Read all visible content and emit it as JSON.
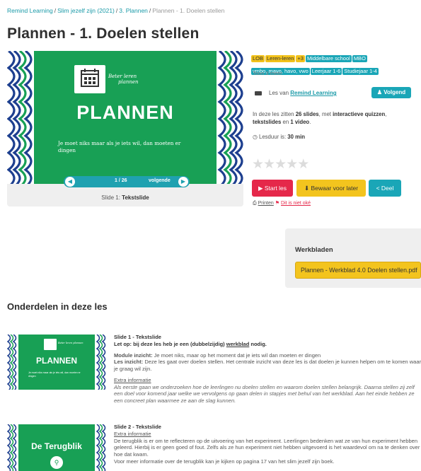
{
  "breadcrumb": {
    "items": [
      "Remind Learning",
      "Slim jezelf zijn (2021)",
      "3. Plannen",
      "Plannen - 1. Doelen stellen"
    ],
    "separator": "/"
  },
  "page_title": "Plannen - 1. Doelen stellen",
  "slide_preview": {
    "logo_text_line1": "Beter leren",
    "logo_text_line2": "plannen",
    "title": "PLANNEN",
    "text": "Je moet niks maar als je iets wil, dan moeten er dingen",
    "counter": "1 / 26",
    "next_label": "volgende",
    "caption_prefix": "Slide 1: ",
    "caption_type": "Tekstslide"
  },
  "tags": {
    "yellow": [
      "LOB",
      "Leren-leren",
      "+3"
    ],
    "teal": [
      "Middelbare school",
      "MBO",
      "vmbo, mavo, havo, vwo",
      "Leerjaar 1-6",
      "Studiejaar 1-4"
    ],
    "show_more": "Toon 3 meer"
  },
  "author": {
    "prefix": "Les van",
    "name": "Remind Learning",
    "follow_label": "Volgend"
  },
  "description": {
    "part1": "In deze les zitten ",
    "slides": "26 slides",
    "part2": ", met ",
    "quizzes": "interactieve quizzen",
    "part3": ", ",
    "textslides": "tekstslides",
    "part4": " en ",
    "videos": "1 video",
    "part5": "."
  },
  "duration": {
    "label": "Lesduur is: ",
    "value": "30 min"
  },
  "rating": {
    "value": 0,
    "max": 5
  },
  "actions": {
    "start": "Start les",
    "save": "Bewaar voor later",
    "share": "Deel"
  },
  "small_links": {
    "print": "Printen",
    "report": "Dit is niet oké"
  },
  "werkbladen": {
    "title": "Werkbladen",
    "file": "Plannen - Werkblad 4.0 Doelen stellen.pdf"
  },
  "section_title": "Onderdelen in deze les",
  "items": [
    {
      "thumb_title": "PLANNEN",
      "thumb_logo_text": "Beter leren plannen",
      "thumb_small_text": "Je moet niks maar als je iets wil, dan moeten er dingen",
      "heading": "Slide 1 - Tekstslide",
      "note_prefix": "Let op: bij deze les heb je een (dubbelzijdig) ",
      "note_link": "werkblad",
      "note_suffix": " nodig.",
      "module_label": "Module inzicht:",
      "module_text": " Je moet niks, maar op het moment dat je iets wil dan moeten er dingen",
      "lesson_label": "Les inzicht:",
      "lesson_text": " Deze les gaat over doelen stellen. Het centrale inzicht van deze les is dat doelen je kunnen helpen om te komen waar je graag wil zijn.",
      "extra_label": "Extra informatie",
      "extra_text": "Als eerste gaan we onderzoeken hoe de leerlingen nu doelen stellen en waarom doelen stellen belangrijk. Daarna stellen zij zelf een doel voor komend jaar welke we vervolgens op gaan delen in stapjes met behul van het werkblad. Aan het einde hebben ze een concreet plan waarmee ze aan de slag kunnen."
    },
    {
      "thumb_title": "De Terugblik",
      "heading": "Slide 2 - Tekstslide",
      "extra_label": "Extra informatie",
      "text1": "De terugblik is er om te reflecteren op de uitvoering van het experiment. Leerlingen bedenken wat ze van hun experiment hebben geleerd. Hierbij is er geen goed of fout. Zelfs als ze hun experiment niet hebben uitgevoerd is het waardevol om na te denken over hoe dat kwam.",
      "text2": "Voor meer informatie over de terugblik kan je kijken op pagina 17 van het slim jezelf zijn boek."
    }
  ],
  "colors": {
    "brand_teal": "#1aa6b7",
    "slide_green": "#18a055",
    "start_red": "#e5284a",
    "save_yellow": "#f3c41e"
  }
}
